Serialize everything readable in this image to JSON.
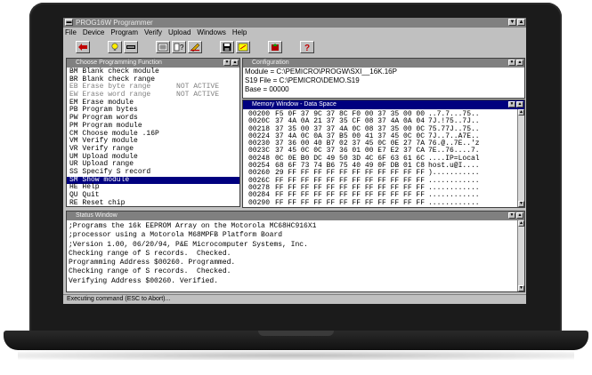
{
  "app": {
    "title": "PROG16W Programmer"
  },
  "menu": [
    "File",
    "Device",
    "Program",
    "Verify",
    "Upload",
    "Windows",
    "Help"
  ],
  "toolbar": {
    "icons": [
      "red-arrow-icon",
      "lightbulb-icon",
      "device-icon",
      "calculator-icon",
      "help-book-icon",
      "edit-icon",
      "save-icon",
      "sparkle-icon",
      "open-icon",
      "question-icon"
    ]
  },
  "functions": {
    "title": "Choose Programming Function",
    "items": [
      {
        "text": "BM Blank check module",
        "state": "normal"
      },
      {
        "text": "BR Blank check range",
        "state": "normal"
      },
      {
        "text": "EB Erase byte range      NOT ACTIVE",
        "state": "disabled"
      },
      {
        "text": "EW Erase word range      NOT ACTIVE",
        "state": "disabled"
      },
      {
        "text": "EM Erase module",
        "state": "normal"
      },
      {
        "text": "PB Program bytes",
        "state": "normal"
      },
      {
        "text": "PW Program words",
        "state": "normal"
      },
      {
        "text": "PM Program module",
        "state": "normal"
      },
      {
        "text": "CM Choose module .16P",
        "state": "normal"
      },
      {
        "text": "VM Verify module",
        "state": "normal"
      },
      {
        "text": "VR Verify range",
        "state": "normal"
      },
      {
        "text": "UM Upload module",
        "state": "normal"
      },
      {
        "text": "UR Upload range",
        "state": "normal"
      },
      {
        "text": "SS Specify S record",
        "state": "normal"
      },
      {
        "text": "SM Show module",
        "state": "selected"
      },
      {
        "text": "HE Help",
        "state": "normal"
      },
      {
        "text": "QU Quit",
        "state": "normal"
      },
      {
        "text": "RE Reset chip",
        "state": "normal"
      }
    ]
  },
  "configuration": {
    "title": "Configuration",
    "lines": [
      "Module = C:\\PEMICRO\\PROGW\\SXI__16K.16P",
      "S19 File = C:\\PEMICRO\\DEMO.S19",
      "Base = 00000"
    ]
  },
  "memory": {
    "title": "Memory Window - Data Space",
    "rows": [
      {
        "addr": "00200",
        "hex": "F5 0F 37 9C 37 8C F0 00 37 35 00 00",
        "ascii": "..7.7...75.."
      },
      {
        "addr": "0020C",
        "hex": "37 4A 0A 21 37 35 CF 08 37 4A 0A 04",
        "ascii": "7J.!75..7J.."
      },
      {
        "addr": "00218",
        "hex": "37 35 00 37 37 4A 0C 08 37 35 00 0C",
        "ascii": "75.77J..75.."
      },
      {
        "addr": "00224",
        "hex": "37 4A 0C 0A 37 B5 00 41 37 45 0C 0C",
        "ascii": "7J..7..A7E.."
      },
      {
        "addr": "00230",
        "hex": "37 36 00 40 B7 02 37 45 0C 0E 27 7A",
        "ascii": "76.@..7E..'z"
      },
      {
        "addr": "0023C",
        "hex": "37 45 0C 0C 37 36 01 00 E7 E2 37 CA",
        "ascii": "7E..76....7."
      },
      {
        "addr": "00248",
        "hex": "0C 0E B0 DC 49 50 3D 4C 6F 63 61 6C",
        "ascii": "....IP=Local"
      },
      {
        "addr": "00254",
        "hex": "68 6F 73 74 B6 75 40 49 0F DB 01 C8",
        "ascii": "host.u@I...."
      },
      {
        "addr": "00260",
        "hex": "29 FF FF FF FF FF FF FF FF FF FF FF",
        "ascii": ")..........."
      },
      {
        "addr": "0026C",
        "hex": "FF FF FF FF FF FF FF FF FF FF FF FF",
        "ascii": "............"
      },
      {
        "addr": "00278",
        "hex": "FF FF FF FF FF FF FF FF FF FF FF FF",
        "ascii": "............"
      },
      {
        "addr": "00284",
        "hex": "FF FF FF FF FF FF FF FF FF FF FF FF",
        "ascii": "............"
      },
      {
        "addr": "00290",
        "hex": "FF FF FF FF FF FF FF FF FF FF FF FF",
        "ascii": "............"
      }
    ]
  },
  "status": {
    "title": "Status Window",
    "lines": [
      ";Programs the 16k EEPROM Array on the Motorola MC68HC916X1",
      ";processor using a Motorola M68MPFB Platform Board",
      ";Version 1.00, 06/20/94, P&E Microcomputer Systems, Inc.",
      "Checking range of S records.  Checked.",
      "Programming Address $00260. Programmed.",
      "Checking range of S records.  Checked.",
      "Verifying Address $00260. Verified."
    ]
  },
  "statusbar": {
    "text": "Executing command (ESC to Abort)..."
  },
  "colors": {
    "window_title_active": "#00007f",
    "window_title_inactive": "#808080",
    "face": "#c0c0c0"
  }
}
